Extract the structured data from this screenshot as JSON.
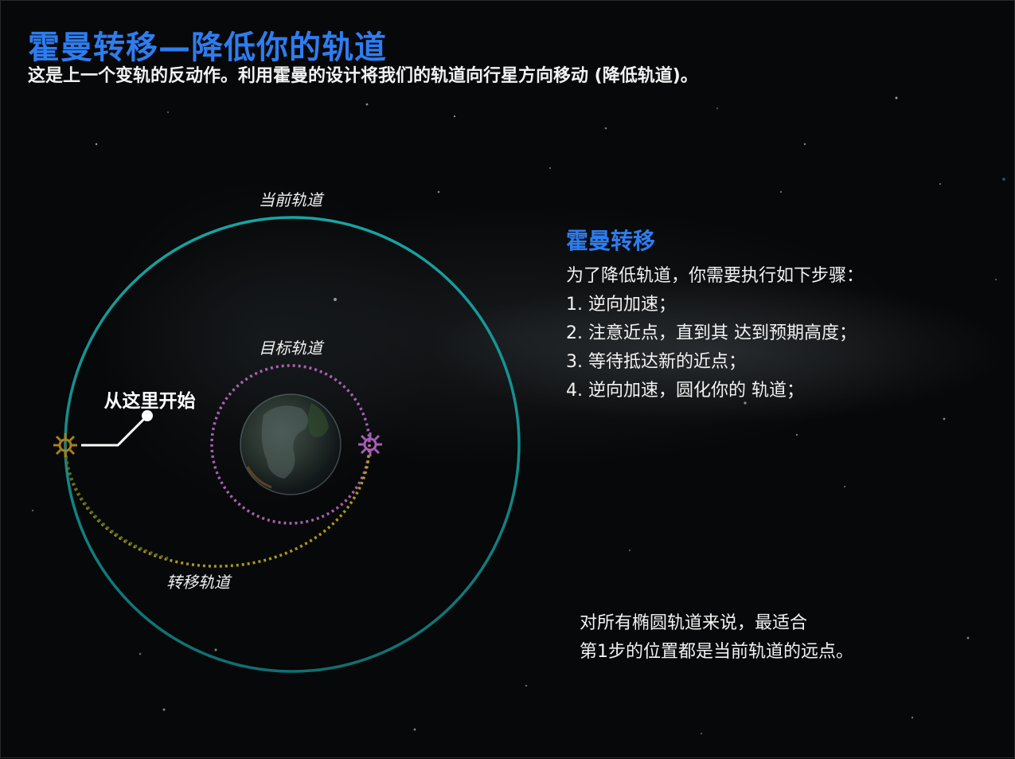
{
  "header": {
    "title": "霍曼转移—降低你的轨道",
    "subtitle": "这是上一个变轨的反动作。利用霍曼的设计将我们的轨道向行星方向移动 (降低轨道)。"
  },
  "diagram": {
    "labels": {
      "current_orbit": "当前轨道",
      "target_orbit": "目标轨道",
      "transfer_orbit": "转移轨道",
      "start_here": "从这里开始"
    },
    "colors": {
      "current_orbit": "#139a96",
      "target_orbit": "#c86ed0",
      "transfer_orbit": "#c8b21e",
      "burn_marker_start": "#a7821c",
      "burn_marker_end": "#a45fb8"
    },
    "icons": [
      "planet-icon",
      "maneuver-node-icon"
    ]
  },
  "panel": {
    "heading": "霍曼转移",
    "intro": "为了降低轨道，你需要执行如下步骤：",
    "steps": [
      "1. 逆向加速；",
      "2. 注意近点，直到其 达到预期高度；",
      "3. 等待抵达新的近点；",
      "4. 逆向加速，圆化你的 轨道；"
    ]
  },
  "note": {
    "line1": "对所有椭圆轨道来说，最适合",
    "line2": "第1步的位置都是当前轨道的远点。"
  }
}
